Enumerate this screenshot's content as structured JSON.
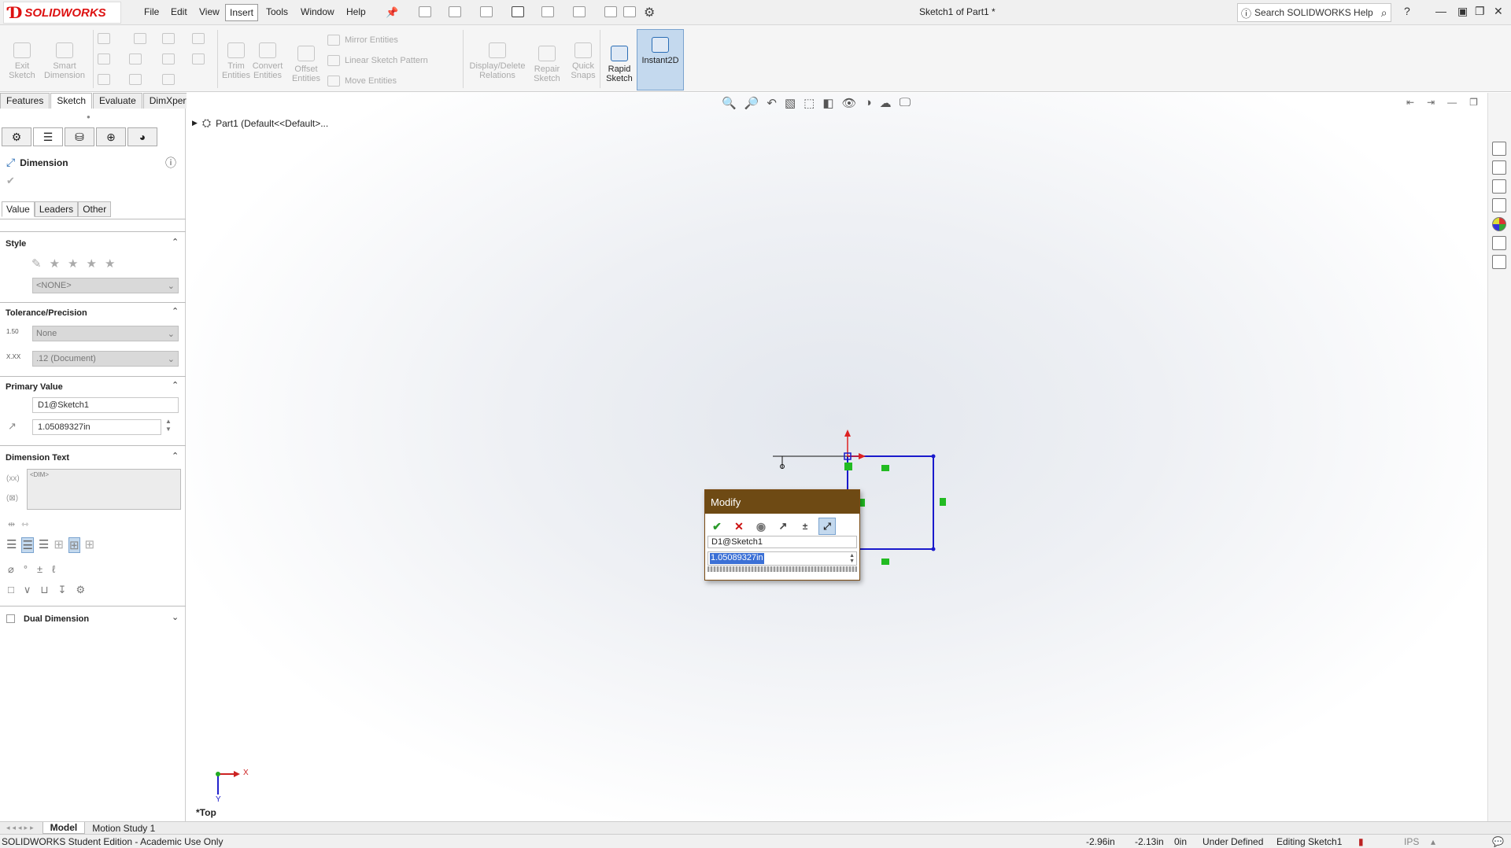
{
  "app": {
    "logo_text": "SOLIDWORKS",
    "document_title": "Sketch1 of Part1 *"
  },
  "menu": [
    "File",
    "Edit",
    "View",
    "Insert",
    "Tools",
    "Window",
    "Help"
  ],
  "menu_active": "Insert",
  "help_search": {
    "placeholder": "Search SOLIDWORKS Help"
  },
  "ribbon": {
    "exit_sketch": "Exit\nSketch",
    "smart_dimension": "Smart\nDimension",
    "trim_entities": "Trim\nEntities",
    "convert_entities": "Convert\nEntities",
    "offset_entities": "Offset\nEntities",
    "mirror_entities": "Mirror Entities",
    "linear_sketch_pattern": "Linear Sketch Pattern",
    "move_entities": "Move Entities",
    "display_delete_relations": "Display/Delete\nRelations",
    "repair_sketch": "Repair\nSketch",
    "quick_snaps": "Quick\nSnaps",
    "rapid_sketch": "Rapid\nSketch",
    "instant2d": "Instant2D"
  },
  "command_tabs": [
    "Features",
    "Sketch",
    "Evaluate",
    "DimXpert"
  ],
  "command_tab_active": "Sketch",
  "tree": {
    "root": "Part1  (Default<<Default>..."
  },
  "property_manager": {
    "title": "Dimension",
    "subtabs": [
      "Value",
      "Leaders",
      "Other"
    ],
    "style": {
      "header": "Style",
      "dropdown": "<NONE>"
    },
    "tolerance": {
      "header": "Tolerance/Precision",
      "tolerance_type": "None",
      "precision": ".12 (Document)",
      "tol_icon_label": "1.50",
      "prec_icon_label": "X.XX"
    },
    "primary_value": {
      "header": "Primary Value",
      "name": "D1@Sketch1",
      "value": "1.05089327in"
    },
    "dimension_text": {
      "header": "Dimension Text",
      "text": "<DIM>"
    },
    "dual_dimension": {
      "label": "Dual Dimension",
      "checked": false
    }
  },
  "modify_dialog": {
    "title": "Modify",
    "name": "D1@Sketch1",
    "value": "1.05089327in"
  },
  "view_label": "*Top",
  "triad": {
    "x": "X",
    "y": "Y"
  },
  "bottom_tabs": [
    "Model",
    "Motion Study 1"
  ],
  "bottom_tab_active": "Model",
  "status": {
    "edition": "SOLIDWORKS Student Edition - Academic Use Only",
    "x": "-2.96in",
    "y": "-2.13in",
    "z": "0in",
    "state": "Under Defined",
    "editing": "Editing Sketch1",
    "units": "IPS"
  },
  "colors": {
    "accent": "#2a6db5",
    "modify_title": "#6e4a14",
    "sketch_line": "#1a1acc",
    "relation_marker": "#22bb22",
    "logo_red": "#d11111"
  }
}
